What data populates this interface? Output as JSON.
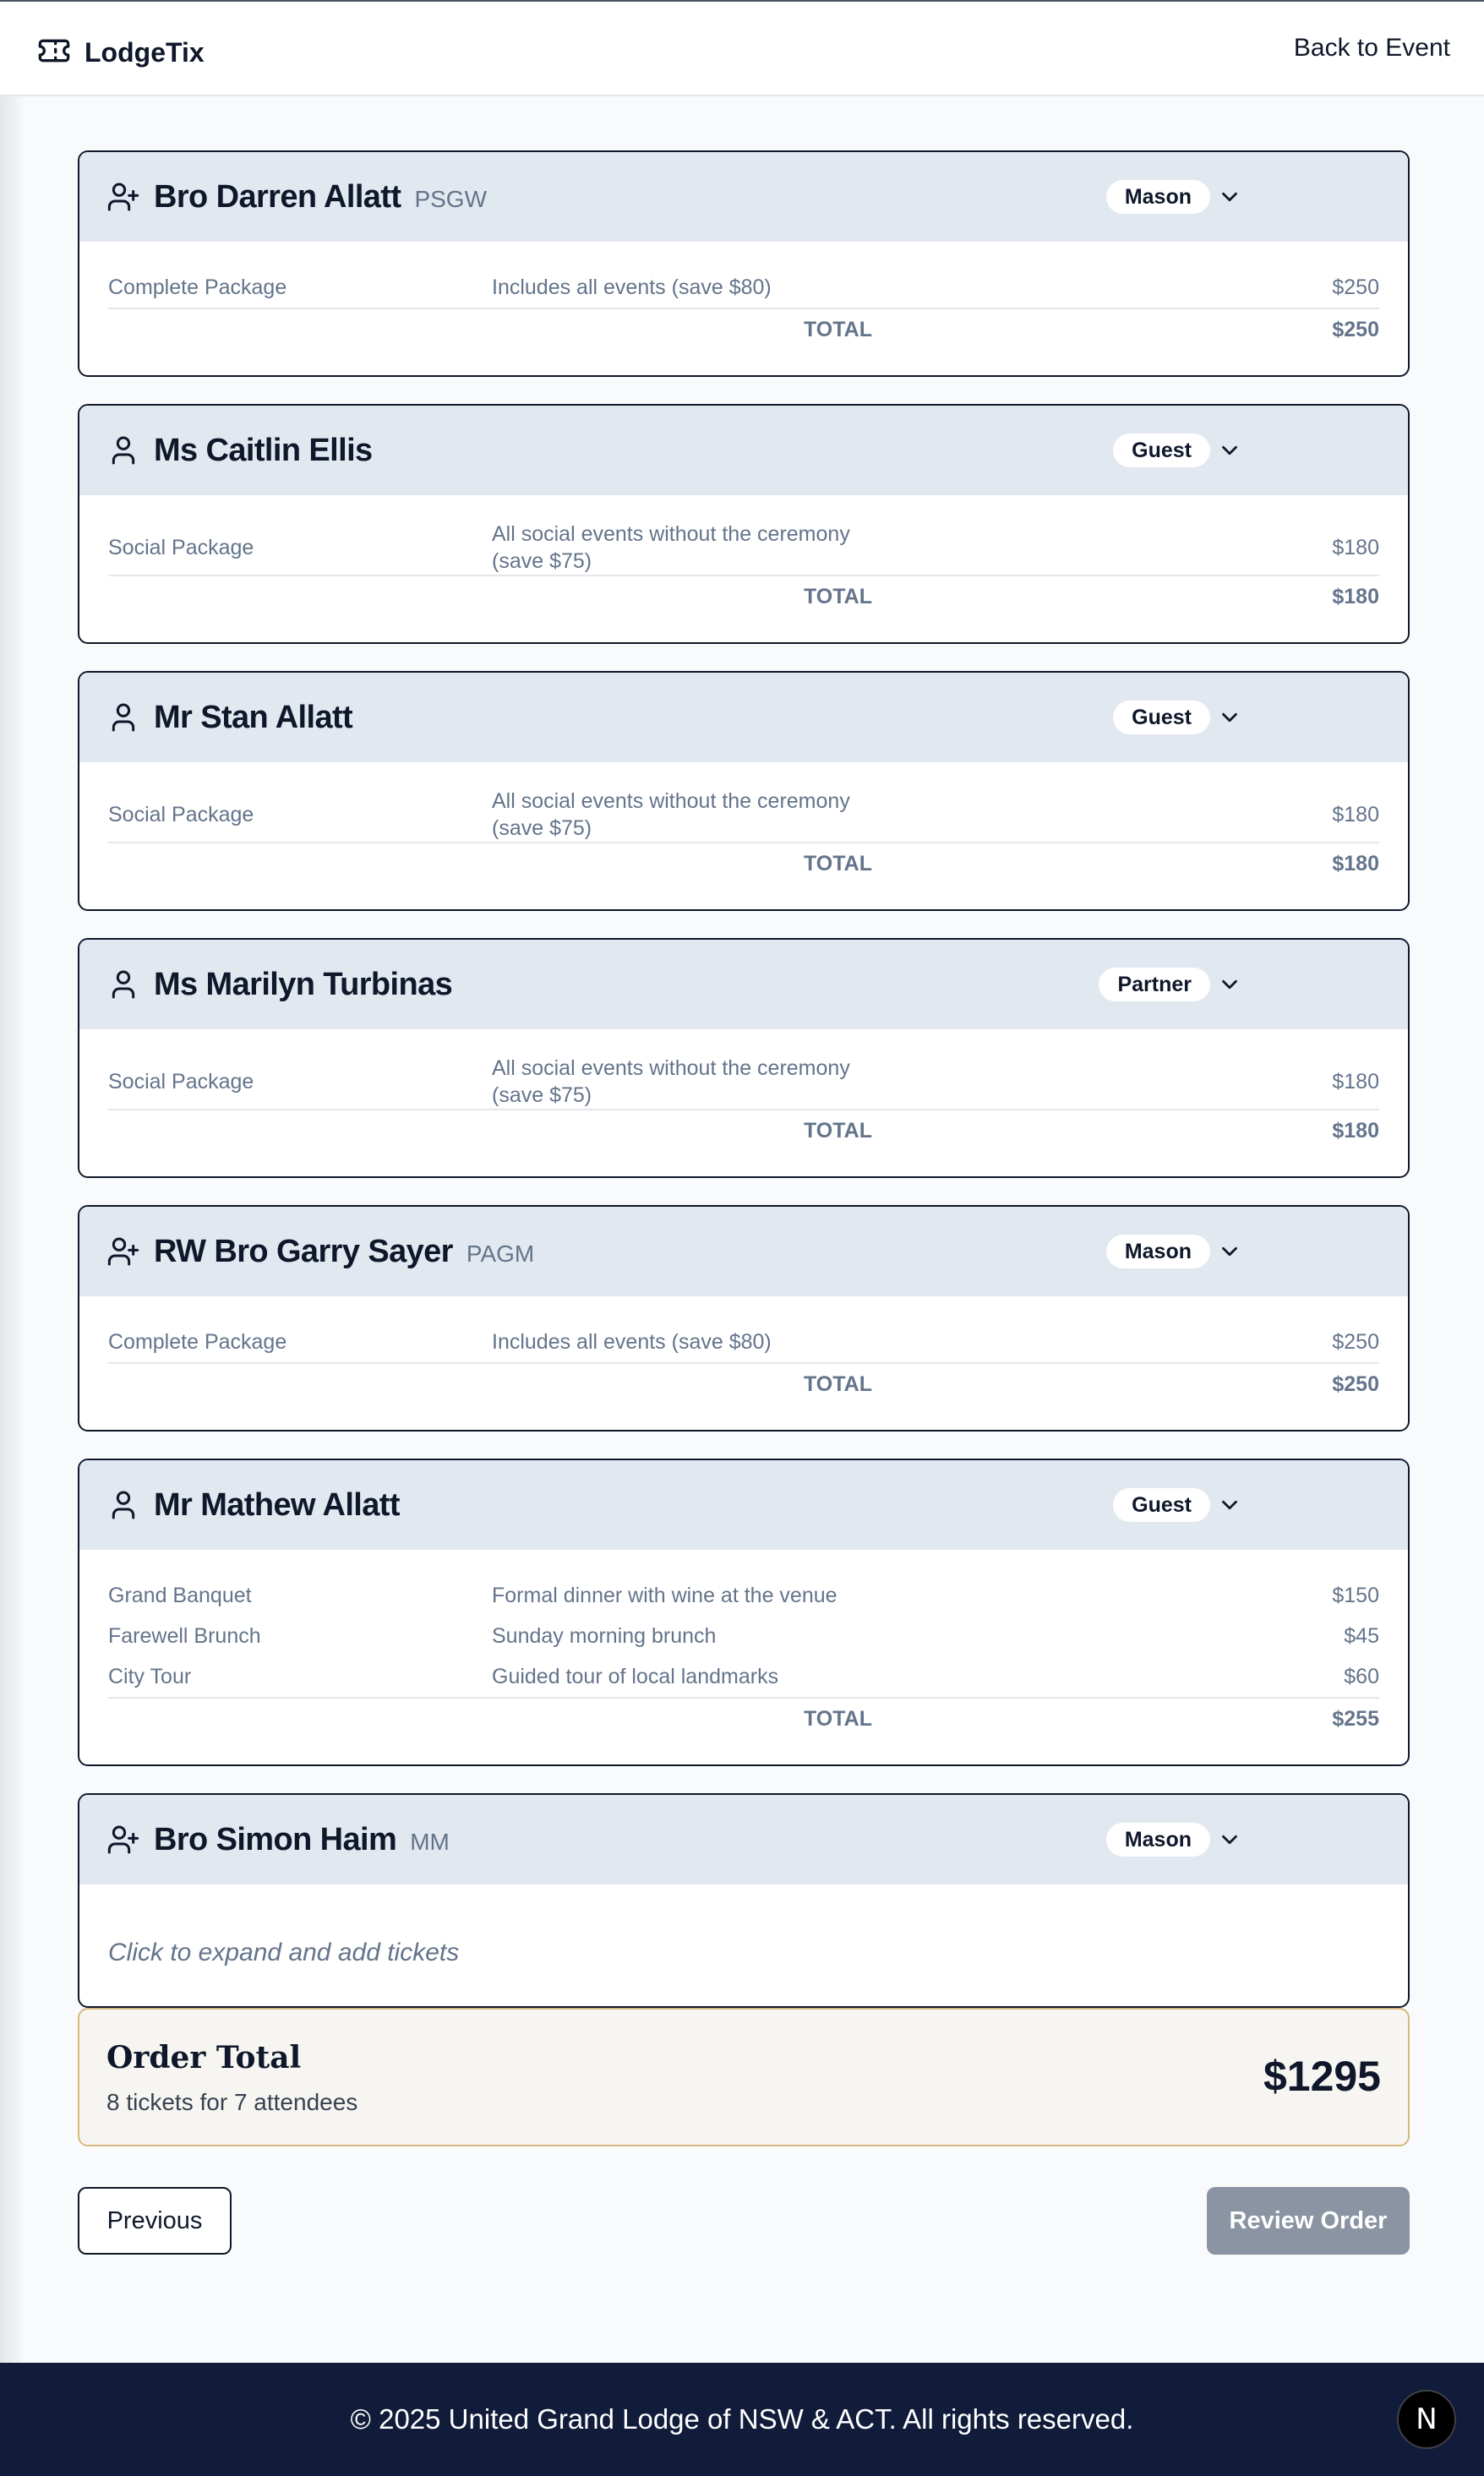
{
  "app": {
    "name": "LodgeTix",
    "back_link": "Back to Event"
  },
  "attendees": [
    {
      "name": "Bro Darren Allatt",
      "rank": "PSGW",
      "type": "Mason",
      "icon": "user-plus-icon",
      "items": [
        {
          "name": "Complete Package",
          "description": "Includes all events (save $80)",
          "price": "$250"
        }
      ],
      "total_label": "TOTAL",
      "total": "$250"
    },
    {
      "name": "Ms Caitlin Ellis",
      "rank": "",
      "type": "Guest",
      "icon": "user-icon",
      "items": [
        {
          "name": "Social Package",
          "description": "All social events without the ceremony (save $75)",
          "price": "$180"
        }
      ],
      "total_label": "TOTAL",
      "total": "$180"
    },
    {
      "name": "Mr Stan Allatt",
      "rank": "",
      "type": "Guest",
      "icon": "user-icon",
      "items": [
        {
          "name": "Social Package",
          "description": "All social events without the ceremony (save $75)",
          "price": "$180"
        }
      ],
      "total_label": "TOTAL",
      "total": "$180"
    },
    {
      "name": "Ms Marilyn Turbinas",
      "rank": "",
      "type": "Partner",
      "icon": "user-icon",
      "items": [
        {
          "name": "Social Package",
          "description": "All social events without the ceremony (save $75)",
          "price": "$180"
        }
      ],
      "total_label": "TOTAL",
      "total": "$180"
    },
    {
      "name": "RW Bro Garry Sayer",
      "rank": "PAGM",
      "type": "Mason",
      "icon": "user-plus-icon",
      "items": [
        {
          "name": "Complete Package",
          "description": "Includes all events (save $80)",
          "price": "$250"
        }
      ],
      "total_label": "TOTAL",
      "total": "$250"
    },
    {
      "name": "Mr Mathew Allatt",
      "rank": "",
      "type": "Guest",
      "icon": "user-icon",
      "items": [
        {
          "name": "Grand Banquet",
          "description": "Formal dinner with wine at the venue",
          "price": "$150"
        },
        {
          "name": "Farewell Brunch",
          "description": "Sunday morning brunch",
          "price": "$45"
        },
        {
          "name": "City Tour",
          "description": "Guided tour of local landmarks",
          "price": "$60"
        }
      ],
      "total_label": "TOTAL",
      "total": "$255"
    },
    {
      "name": "Bro Simon Haim",
      "rank": "MM",
      "type": "Mason",
      "icon": "user-plus-icon",
      "items": [],
      "empty_text": "Click to expand and add tickets"
    }
  ],
  "order_total": {
    "title": "Order Total",
    "subtitle": "8 tickets for 7 attendees",
    "amount": "$1295"
  },
  "nav": {
    "previous": "Previous",
    "review": "Review Order"
  },
  "footer": {
    "copyright": "© 2025 United Grand Lodge of NSW & ACT. All rights reserved.",
    "badge": "N"
  },
  "colors": {
    "navy": "#111c3b",
    "card_header": "#e2e8f0",
    "order_border": "#d6b87c",
    "review_button": "#8a94a3"
  }
}
